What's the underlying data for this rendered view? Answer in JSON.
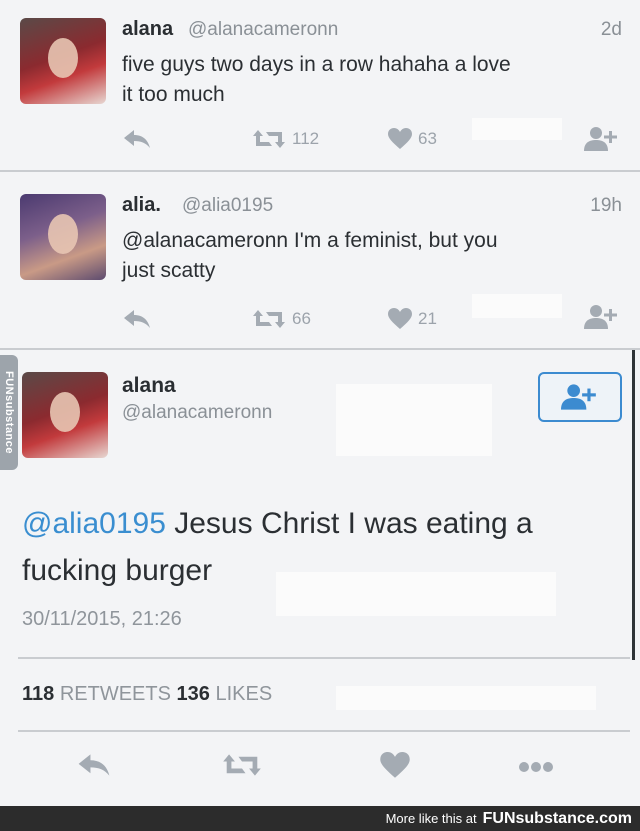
{
  "tweets": [
    {
      "name": "alana",
      "handle": "@alanacameronn",
      "time": "2d",
      "text_line1": "five guys two days in a row hahaha a love",
      "text_line2": "it too much",
      "retweets": "112",
      "likes": "63"
    },
    {
      "name": "alia.",
      "handle": "@alia0195",
      "time": "19h",
      "text_line1": "@alanacameronn I'm a feminist, but you",
      "text_line2": "just scatty",
      "retweets": "66",
      "likes": "21"
    }
  ],
  "detail": {
    "name": "alana",
    "handle": "@alanacameronn",
    "mention": "@alia0195",
    "text_line1": " Jesus Christ I was eating a",
    "text_line2": "fucking burger",
    "date": "30/11/2015, 21:26",
    "retweet_count": "118",
    "retweet_label": "RETWEETS",
    "like_count": "136",
    "like_label": "LIKES"
  },
  "watermark": {
    "side_tab": "FUNsubstance",
    "footer_prefix": "More like this at",
    "footer_brand": "FUNsubstance.com"
  },
  "colors": {
    "accent": "#3a8ed0",
    "muted": "#8f959b"
  }
}
